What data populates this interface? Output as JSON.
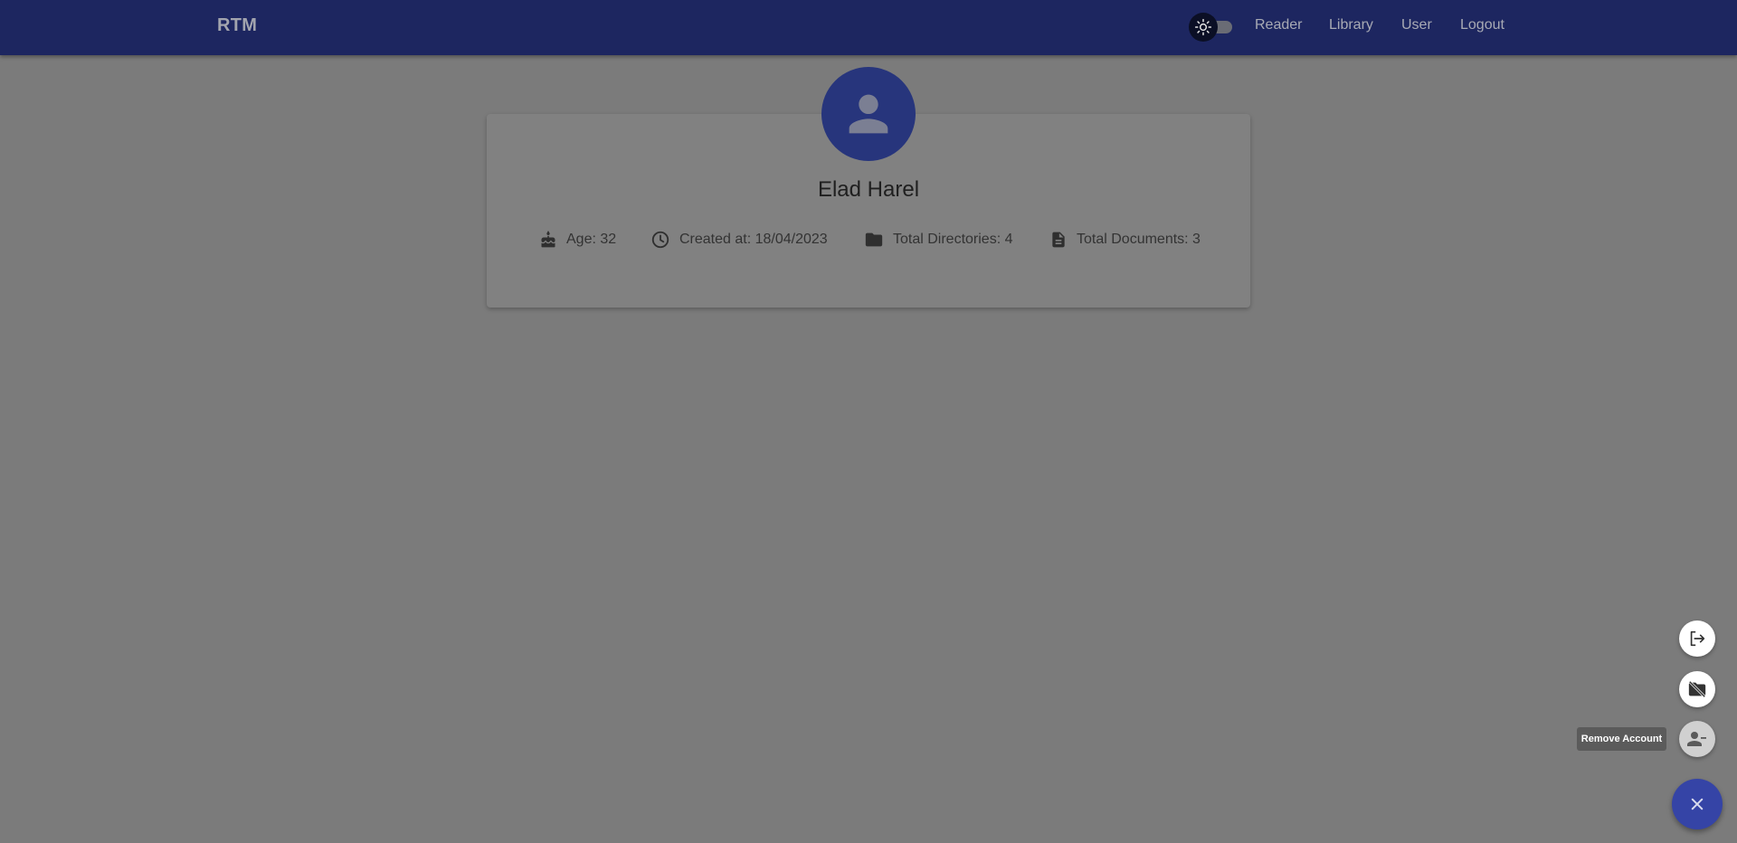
{
  "app": {
    "brand": "RTM"
  },
  "nav": {
    "reader": "Reader",
    "library": "Library",
    "user": "User",
    "logout": "Logout"
  },
  "profile": {
    "name": "Elad Harel",
    "age": "Age: 32",
    "created_at": "Created at: 18/04/2023",
    "total_directories": "Total Directories: 4",
    "total_documents": "Total Documents: 3"
  },
  "speed_dial": {
    "tooltip": "Remove Account"
  },
  "icons": {
    "theme": "sun-icon",
    "avatar": "person-icon",
    "age": "cake-icon",
    "created": "clock-icon",
    "directories": "folder-icon",
    "documents": "document-icon",
    "logout_action": "logout-icon",
    "remove_directories_action": "folder-off-icon",
    "remove_account_action": "person-remove-icon",
    "close": "close-icon"
  },
  "colors": {
    "appbar": "#1d2660",
    "overlay_background": "#7b7b7b",
    "avatar": "#27357c",
    "fab": "#3544a6"
  }
}
